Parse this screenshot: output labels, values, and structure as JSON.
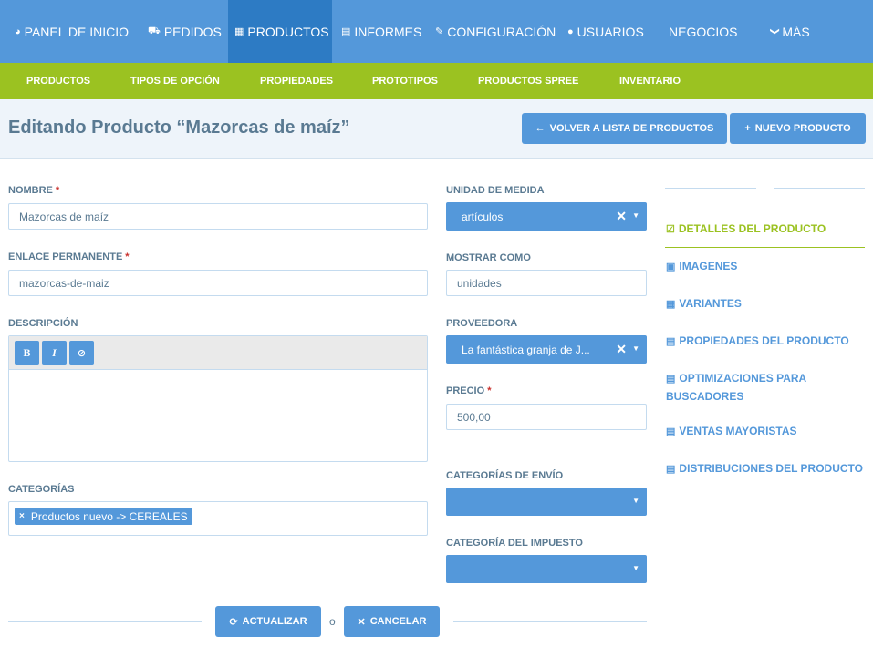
{
  "top_nav": {
    "items": [
      {
        "icon": "dashboard-icon",
        "glyph": "◕",
        "label": "PANEL DE INICIO"
      },
      {
        "icon": "cart-icon",
        "glyph": "⛟",
        "label": "PEDIDOS"
      },
      {
        "icon": "grid-icon",
        "glyph": "▦",
        "label": "PRODUCTOS"
      },
      {
        "icon": "file-icon",
        "glyph": "▤",
        "label": "INFORMES"
      },
      {
        "icon": "wrench-icon",
        "glyph": "✎",
        "label": "CONFIGURACIÓN"
      },
      {
        "icon": "user-icon",
        "glyph": "●",
        "label": "USUARIOS"
      },
      {
        "icon": "",
        "glyph": "",
        "label": "NEGOCIOS"
      },
      {
        "icon": "chevron-down-icon",
        "glyph": "❯",
        "label": "MÁS"
      }
    ]
  },
  "sub_nav": {
    "items": [
      "PRODUCTOS",
      "TIPOS DE OPCIÓN",
      "PROPIEDADES",
      "PROTOTIPOS",
      "PRODUCTOS SPREE",
      "INVENTARIO"
    ]
  },
  "header": {
    "title": "Editando Producto “Mazorcas de maíz”",
    "back_button": "VOLVER A LISTA DE PRODUCTOS",
    "new_button": "NUEVO PRODUCTO"
  },
  "form": {
    "name": {
      "label": "NOMBRE",
      "required": "*",
      "value": "Mazorcas de maíz"
    },
    "permalink": {
      "label": "ENLACE PERMANENTE",
      "required": "*",
      "value": "mazorcas-de-maiz"
    },
    "description": {
      "label": "DESCRIPCIÓN",
      "bold": "B",
      "italic": "I",
      "clear": "⊘"
    },
    "categories": {
      "label": "CATEGORÍAS",
      "tag": "Productos nuevo -> CEREALES",
      "tag_remove": "×"
    },
    "unit": {
      "label": "UNIDAD DE MEDIDA",
      "value": "artículos"
    },
    "display_as": {
      "label": "MOSTRAR COMO",
      "value": "unidades"
    },
    "supplier": {
      "label": "PROVEEDORA",
      "value": "La fantástica granja de J..."
    },
    "price": {
      "label": "PRECIO",
      "required": "*",
      "value": "500,00"
    },
    "shipping": {
      "label": "CATEGORÍAS DE ENVÍO",
      "value": ""
    },
    "tax": {
      "label": "CATEGORÍA DEL IMPUESTO",
      "value": ""
    },
    "clear_glyph": "✕",
    "arrow_glyph": "▼"
  },
  "sidebar": {
    "items": [
      {
        "icon": "edit-icon",
        "glyph": "☑",
        "label": "DETALLES DEL PRODUCTO"
      },
      {
        "icon": "image-icon",
        "glyph": "▣",
        "label": "IMAGENES"
      },
      {
        "icon": "grid-icon",
        "glyph": "▦",
        "label": "VARIANTES"
      },
      {
        "icon": "list-icon",
        "glyph": "▤",
        "label": "PROPIEDADES DEL PRODUCTO"
      },
      {
        "icon": "list-icon",
        "glyph": "▤",
        "label": "OPTIMIZACIONES PARA",
        "label2": "BUSCADORES"
      },
      {
        "icon": "list-icon",
        "glyph": "▤",
        "label": "VENTAS MAYORISTAS"
      },
      {
        "icon": "list-icon",
        "glyph": "▤",
        "label": "DISTRIBUCIONES DEL PRODUCTO"
      }
    ]
  },
  "footer": {
    "update_label": "ACTUALIZAR",
    "update_glyph": "⟳",
    "or_label": "o",
    "cancel_label": "CANCELAR",
    "cancel_glyph": "✕"
  },
  "glyphs": {
    "back": "←",
    "plus": "+"
  },
  "colors": {
    "primary": "#5498da",
    "active_nav": "#2d7bc4",
    "subnav": "#9bc221",
    "text": "#5a7a92",
    "required": "#c9302c"
  }
}
